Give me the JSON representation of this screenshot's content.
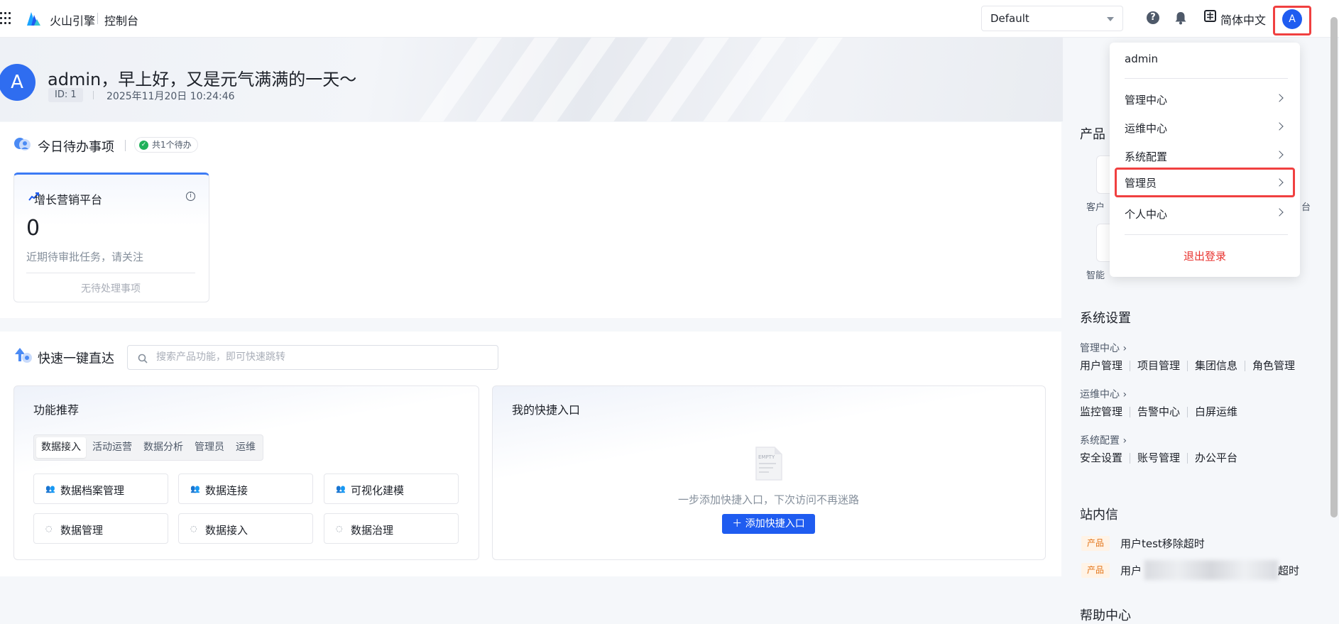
{
  "topbar": {
    "brand": "火山引擎",
    "console": "控制台",
    "project_select": "Default",
    "language": "简体中文",
    "avatar_letter": "A"
  },
  "header": {
    "avatar_letter": "A",
    "greeting": "admin，早上好，又是元气满满的一天～",
    "id_badge": "ID: 1",
    "datetime": "2025年11月20日 10:24:46"
  },
  "todo": {
    "title": "今日待办事项",
    "pending_badge": "共1个待办",
    "card": {
      "title": "增长营销平台",
      "count": "0",
      "desc": "近期待审批任务，请关注",
      "empty": "无待处理事项"
    }
  },
  "quick": {
    "title": "快速一键直达",
    "search_placeholder": "搜索产品功能，即可快速跳转",
    "recommend": {
      "title": "功能推荐",
      "tabs": [
        "数据接入",
        "活动运营",
        "数据分析",
        "管理员",
        "运维"
      ],
      "active_tab": "数据接入",
      "items": [
        "数据档案管理",
        "数据连接",
        "可视化建模",
        "数据管理",
        "数据接入",
        "数据治理"
      ]
    },
    "my_shortcuts": {
      "title": "我的快捷入口",
      "empty_icon_text": "EMPTY",
      "empty_text": "一步添加快捷入口，下次访问不再迷路",
      "add_button": "＋ 添加快捷入口"
    }
  },
  "right": {
    "products_title_partial": "产品",
    "prod_tile_labels": [
      "客户",
      "智能"
    ],
    "prod_tile_suffix": "台",
    "system_settings": {
      "title": "系统设置",
      "groups": [
        {
          "name": "管理中心 ›",
          "links": [
            "用户管理",
            "项目管理",
            "集团信息",
            "角色管理"
          ]
        },
        {
          "name": "运维中心 ›",
          "links": [
            "监控管理",
            "告警中心",
            "白屏运维"
          ]
        },
        {
          "name": "系统配置 ›",
          "links": [
            "安全设置",
            "账号管理",
            "办公平台"
          ]
        }
      ]
    },
    "inbox": {
      "title": "站内信",
      "messages": [
        {
          "tag": "产品",
          "text": "用户test移除超时"
        },
        {
          "tag": "产品",
          "text_start": "用户",
          "text_end": "超时"
        }
      ]
    },
    "help_title": "帮助中心"
  },
  "user_menu": {
    "username": "admin",
    "items": [
      "管理中心",
      "运维中心",
      "系统配置",
      "管理员",
      "个人中心"
    ],
    "logout": "退出登录"
  },
  "colors": {
    "accent": "#1f5cf0",
    "highlight_border": "#f04040",
    "logout": "#e8332f",
    "tag_bg": "#fff3e6",
    "tag_text": "#e37318"
  }
}
